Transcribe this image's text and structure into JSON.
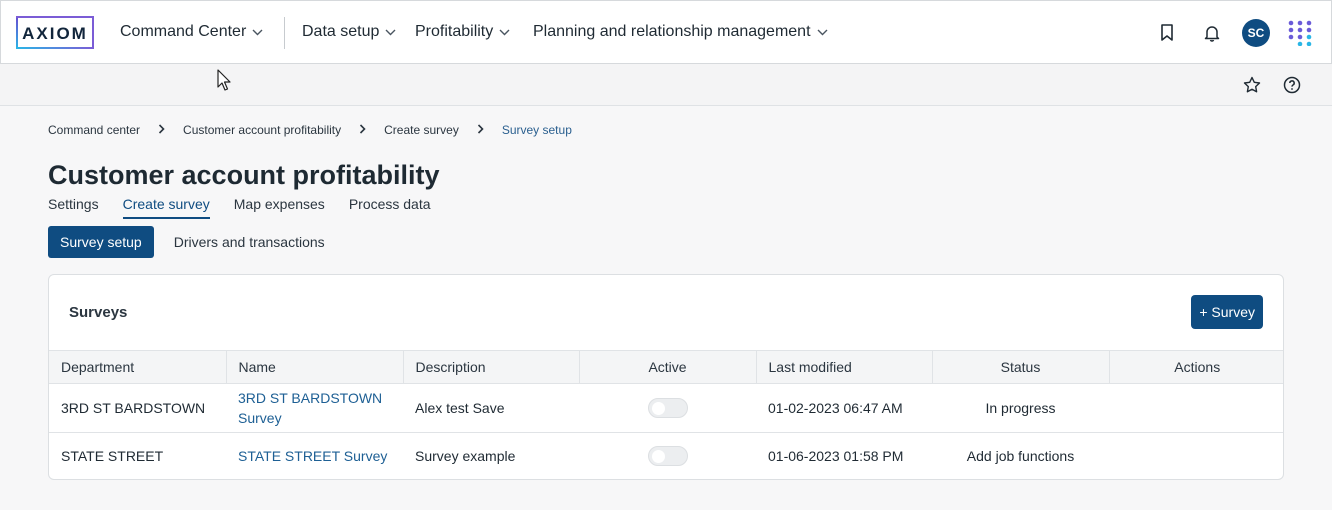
{
  "logo": {
    "text": "AXIOM"
  },
  "nav": [
    {
      "label": "Command Center"
    },
    {
      "label": "Data setup"
    },
    {
      "label": "Profitability"
    },
    {
      "label": "Planning and relationship management"
    }
  ],
  "user": {
    "initials": "SC"
  },
  "breadcrumb": [
    "Command center",
    "Customer account profitability",
    "Create survey",
    "Survey setup"
  ],
  "page": {
    "title": "Customer account profitability"
  },
  "tabs": [
    "Settings",
    "Create survey",
    "Map expenses",
    "Process data"
  ],
  "subtabs": [
    "Survey setup",
    "Drivers and transactions"
  ],
  "surveys": {
    "title": "Surveys",
    "add_label": "+ Survey",
    "columns": [
      "Department",
      "Name",
      "Description",
      "Active",
      "Last modified",
      "Status",
      "Actions"
    ],
    "rows": [
      {
        "department": "3RD ST BARDSTOWN",
        "name": "3RD ST BARDSTOWN Survey",
        "description": "Alex test Save",
        "active": false,
        "last_modified": "01-02-2023 06:47 AM",
        "status": "In progress"
      },
      {
        "department": "STATE STREET",
        "name": "STATE STREET Survey",
        "description": "Survey example",
        "active": false,
        "last_modified": "01-06-2023 01:58 PM",
        "status": "Add job functions"
      }
    ]
  },
  "colors": {
    "primary": "#0f4c81",
    "link": "#1d5f94"
  }
}
